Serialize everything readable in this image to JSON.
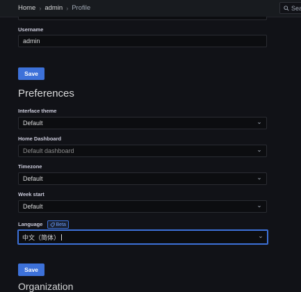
{
  "breadcrumb": {
    "home": "Home",
    "admin": "admin",
    "current": "Profile"
  },
  "search": {
    "placeholder": "Sea"
  },
  "username": {
    "label": "Username",
    "value": "admin"
  },
  "save_top": "Save",
  "preferences": {
    "title": "Preferences",
    "interface_theme": {
      "label": "Interface theme",
      "value": "Default"
    },
    "home_dashboard": {
      "label": "Home Dashboard",
      "placeholder": "Default dashboard"
    },
    "timezone": {
      "label": "Timezone",
      "value": "Default"
    },
    "week_start": {
      "label": "Week start",
      "value": "Default"
    },
    "language": {
      "label": "Language",
      "badge": "Beta",
      "value": "中文（简体）"
    }
  },
  "save_bottom": "Save",
  "next_section": {
    "title": "Organization"
  }
}
